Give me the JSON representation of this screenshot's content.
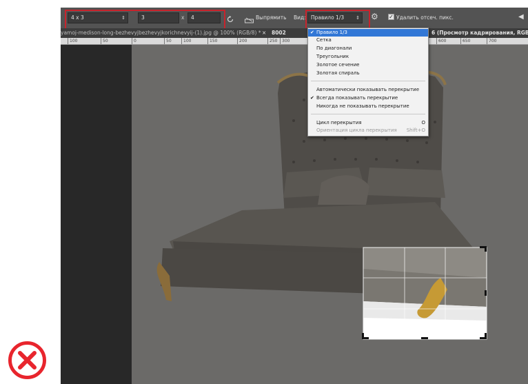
{
  "options_bar": {
    "ratio_preset": "4 x 3",
    "width_value": "3",
    "times_sign": "x",
    "height_value": "4",
    "straighten_label": "Выпрямить",
    "view_label": "Вид:",
    "view_value": "Правило 1/3",
    "delete_cropped_label": "Удалить отсеч. пикс."
  },
  "tabs": {
    "active_doc": "yamoj-medison-long-bezhevyjbezhevyjkorichnevyij-(1).jpg @ 100% (RGB/8) *",
    "close_glyph": "×",
    "second_doc_prefix": "8002",
    "second_doc_suffix": "6 (Просмотр кадрирования, RGB/"
  },
  "ruler_marks": [
    "100",
    "50",
    "0",
    "50",
    "100",
    "150",
    "200",
    "250",
    "300",
    "600",
    "650",
    "700"
  ],
  "view_menu": {
    "items": [
      {
        "label": "Правило 1/3",
        "checked": true,
        "selected": true
      },
      {
        "label": "Сетка"
      },
      {
        "label": "По диагонали"
      },
      {
        "label": "Треугольник"
      },
      {
        "label": "Золотое сечение"
      },
      {
        "label": "Золотая спираль"
      },
      {
        "label": "Автоматически показывать перекрытие"
      },
      {
        "label": "Всегда показывать перекрытие",
        "checked": true
      },
      {
        "label": "Никогда не показывать перекрытие"
      },
      {
        "label": "Цикл перекрытия",
        "shortcut": "O"
      },
      {
        "label": "Ориентация цикла перекрытия",
        "shortcut": "Shift+O",
        "disabled": true
      }
    ]
  },
  "colors": {
    "highlight_red": "#c8232c",
    "error_red": "#e8252d",
    "menu_selected": "#3277d6",
    "toolbar": "#535353"
  },
  "icons": [
    "chevron-updown-icon",
    "rotate-icon",
    "level-icon",
    "gear-icon",
    "checkbox-checked-icon",
    "arrow-left-icon",
    "error-x-icon"
  ]
}
